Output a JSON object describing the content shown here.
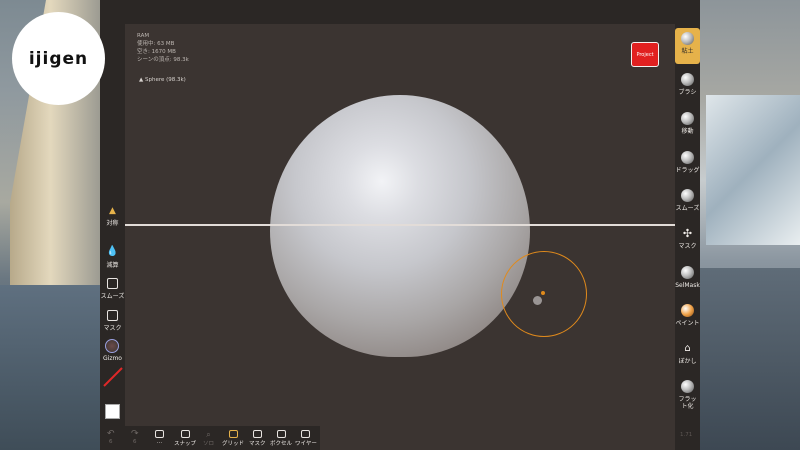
{
  "logo": {
    "text": "ijigen"
  },
  "info": {
    "line1": "RAM",
    "line2": "使用中: 63 MB",
    "line3": "空き: 1670 MB",
    "line4": "シーンの頂点: 98.3k"
  },
  "object": {
    "label": "Sphere (98.3k)"
  },
  "project_button": {
    "label": "Project"
  },
  "left_tools": {
    "symmetry": "対称",
    "decay": "減算",
    "smooth": "スムーズ",
    "mask": "マスク",
    "gizmo": "Gizmo"
  },
  "right_tools": {
    "clay": "粘土",
    "brush": "ブラシ",
    "move": "移動",
    "drag": "ドラッグ",
    "smooth": "スムーズ",
    "mask": "マスク",
    "selmask": "SelMask",
    "paint": "ペイント",
    "blur": "ぼかし",
    "flatten": "フラット化"
  },
  "bottom": {
    "undo_count": "6",
    "redo_count": "6",
    "snap": "スナップ",
    "zoom": "ソロ",
    "grid": "グリッド",
    "mask": "マスク",
    "voxel": "ボクセル",
    "wire": "ワイヤー"
  },
  "version": "1.71",
  "colors": {
    "accent": "#e6b24a",
    "brush_ring": "#e08a1c",
    "project": "#e12020"
  },
  "slider_levels": {
    "radius": 0.12,
    "intensity": 0.5
  }
}
